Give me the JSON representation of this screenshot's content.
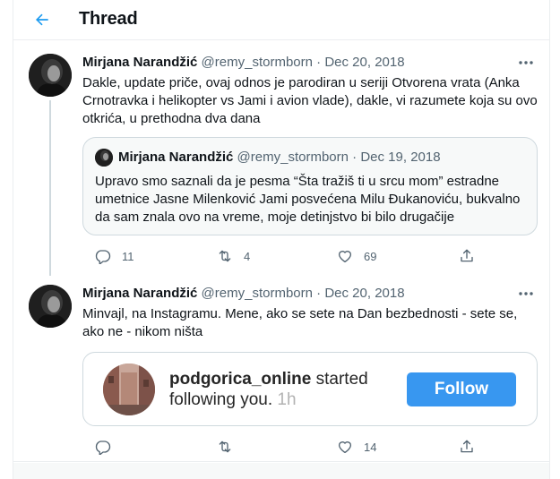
{
  "header": {
    "title": "Thread"
  },
  "tweets": [
    {
      "name": "Mirjana Narandžić",
      "handle": "@remy_stormborn",
      "separator": "·",
      "date": "Dec 20, 2018",
      "text": "Dakle, update priče, ovaj odnos je parodiran u seriji Otvorena vrata (Anka Crnotravka i helikopter vs Jami i avion vlade), dakle, vi razumete koja su ovo otkrića, u prethodna dva dana",
      "quote": {
        "name": "Mirjana Narandžić",
        "handle": "@remy_stormborn",
        "separator": "·",
        "date": "Dec 19, 2018",
        "text": "Upravo smo saznali da je pesma “Šta tražiš ti u srcu mom” estradne umetnice Jasne Milenković Jami posvećena Milu Đukanoviću, bukvalno da sam znala ovo na vreme, moje detinjstvo bi bilo drugačije"
      },
      "actions": {
        "replies": "11",
        "retweets": "4",
        "likes": "69"
      }
    },
    {
      "name": "Mirjana Narandžić",
      "handle": "@remy_stormborn",
      "separator": "·",
      "date": "Dec 20, 2018",
      "text": "Minvajl, na Instagramu. Mene, ako se sete na Dan bezbednosti - sete se, ako ne - nikom ništa",
      "media": {
        "username": "podgorica_online",
        "message": " started following you.",
        "time": " 1h",
        "follow_label": "Follow"
      },
      "actions": {
        "replies": "",
        "retweets": "",
        "likes": "14"
      }
    }
  ],
  "colors": {
    "accent": "#1d9bf0",
    "muted": "#536471",
    "border": "#cfd9de",
    "instagram_blue": "#3897f0"
  }
}
